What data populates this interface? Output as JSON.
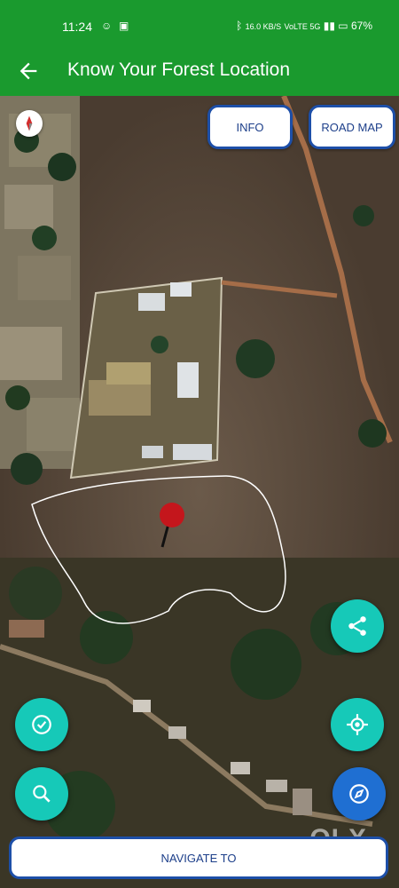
{
  "status_bar": {
    "time": "11:24",
    "network_speed": "16.0 KB/S",
    "signal_label": "VoLTE 5G",
    "battery": "67%"
  },
  "app_bar": {
    "title": "Know Your Forest Location",
    "back_icon": "arrow-left-icon"
  },
  "map": {
    "info_button": "INFO",
    "road_map_button": "ROAD MAP",
    "compass_icon": "compass-north-icon",
    "marker_color": "#c4161c"
  },
  "fabs": {
    "share_icon": "share-icon",
    "check_icon": "check-circle-icon",
    "locate_icon": "my-location-icon",
    "search_icon": "search-icon",
    "navigate_icon": "compass-navigate-icon"
  },
  "navigate_button": "NAVIGATE TO",
  "watermark": "OLX",
  "colors": {
    "primary": "#1a9a2e",
    "fab_teal": "#16c9b8",
    "fab_blue": "#1f6fd2",
    "button_border": "#1d4fa8"
  }
}
